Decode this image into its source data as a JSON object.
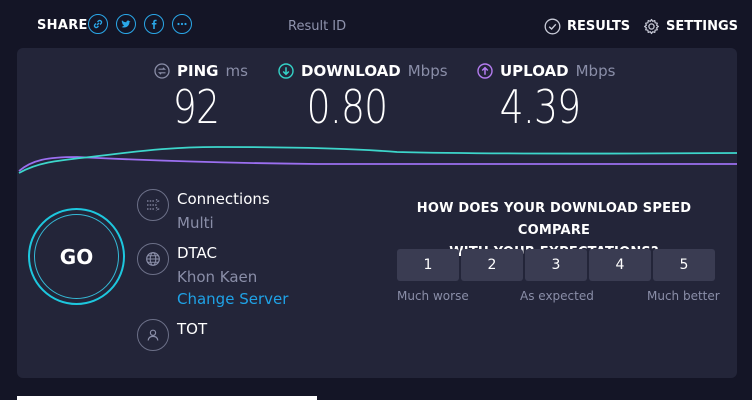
{
  "header": {
    "share_label": "SHARE",
    "result_id_label": "Result ID",
    "results_label": "RESULTS",
    "settings_label": "SETTINGS"
  },
  "metrics": {
    "ping": {
      "label": "PING",
      "unit": "ms",
      "value": "92"
    },
    "download": {
      "label": "DOWNLOAD",
      "unit": "Mbps",
      "value": "0.80"
    },
    "upload": {
      "label": "UPLOAD",
      "unit": "Mbps",
      "value": "4.39"
    }
  },
  "go_label": "GO",
  "connections": {
    "title": "Connections",
    "value": "Multi"
  },
  "server": {
    "name": "DTAC",
    "location": "Khon Kaen",
    "change_label": "Change Server"
  },
  "isp": {
    "name": "TOT"
  },
  "survey": {
    "question_line1": "HOW DOES YOUR DOWNLOAD SPEED COMPARE",
    "question_line2": "WITH YOUR EXPECTATIONS?",
    "options": [
      "1",
      "2",
      "3",
      "4",
      "5"
    ],
    "label_low": "Much worse",
    "label_mid": "As expected",
    "label_high": "Much better"
  },
  "colors": {
    "accent": "#1dc7de",
    "download_icon": "#34d3c8",
    "upload_icon": "#b47cf0",
    "upload_line": "#9b6ff0",
    "link": "#1fa2e6"
  }
}
